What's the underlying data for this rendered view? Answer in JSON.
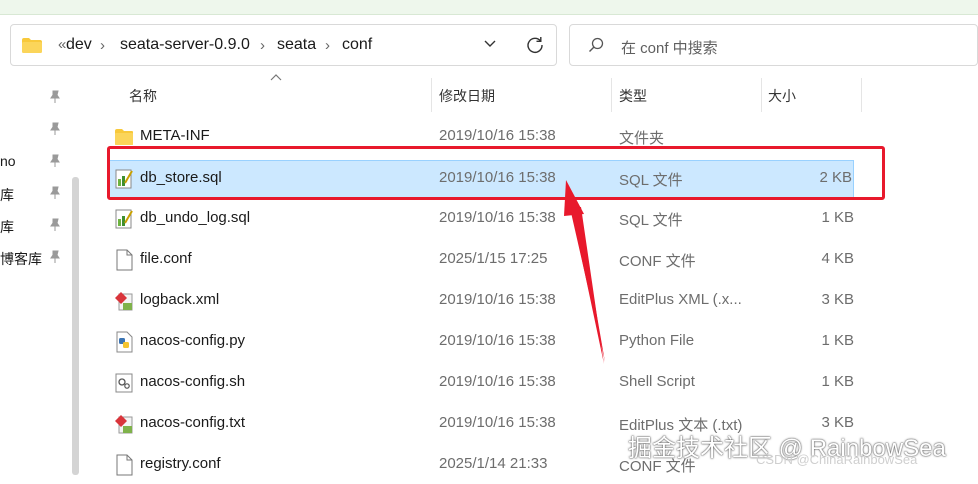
{
  "address_bar": {
    "overflow_glyph": "«",
    "breadcrumbs": [
      "dev",
      "seata-server-0.9.0",
      "seata",
      "conf"
    ]
  },
  "search": {
    "placeholder": "在 conf 中搜索"
  },
  "sidebar": {
    "items": [
      {
        "label": ""
      },
      {
        "label": ""
      },
      {
        "label": "no"
      },
      {
        "label": "库"
      },
      {
        "label": "库"
      },
      {
        "label": "博客库"
      }
    ]
  },
  "columns": {
    "name": "名称",
    "date": "修改日期",
    "type": "类型",
    "size": "大小"
  },
  "files": [
    {
      "name": "META-INF",
      "date": "2019/10/16 15:38",
      "type": "文件夹",
      "size": "",
      "icon": "folder-icon"
    },
    {
      "name": "db_store.sql",
      "date": "2019/10/16 15:38",
      "type": "SQL 文件",
      "size": "2 KB",
      "icon": "sql-file-icon",
      "selected": true
    },
    {
      "name": "db_undo_log.sql",
      "date": "2019/10/16 15:38",
      "type": "SQL 文件",
      "size": "1 KB",
      "icon": "sql-file-icon"
    },
    {
      "name": "file.conf",
      "date": "2025/1/15 17:25",
      "type": "CONF 文件",
      "size": "4 KB",
      "icon": "blank-file-icon"
    },
    {
      "name": "logback.xml",
      "date": "2019/10/16 15:38",
      "type": "EditPlus XML (.x...",
      "size": "3 KB",
      "icon": "editplus-file-icon"
    },
    {
      "name": "nacos-config.py",
      "date": "2019/10/16 15:38",
      "type": "Python File",
      "size": "1 KB",
      "icon": "python-file-icon"
    },
    {
      "name": "nacos-config.sh",
      "date": "2019/10/16 15:38",
      "type": "Shell Script",
      "size": "1 KB",
      "icon": "shell-file-icon"
    },
    {
      "name": "nacos-config.txt",
      "date": "2019/10/16 15:38",
      "type": "EditPlus 文本 (.txt)",
      "size": "3 KB",
      "icon": "editplus-file-icon"
    },
    {
      "name": "registry.conf",
      "date": "2025/1/14 21:33",
      "type": "CONF 文件",
      "size": "",
      "icon": "blank-file-icon"
    }
  ],
  "watermark": {
    "main": "掘金技术社区 @ RainbowSea",
    "sub": "CSDN @ChinaRainbowSea"
  },
  "colors": {
    "selection_bg": "#cce8ff",
    "selection_border": "#99d1ff",
    "annotation_red": "#e8192c",
    "folder_yellow": "#f8c93b"
  }
}
